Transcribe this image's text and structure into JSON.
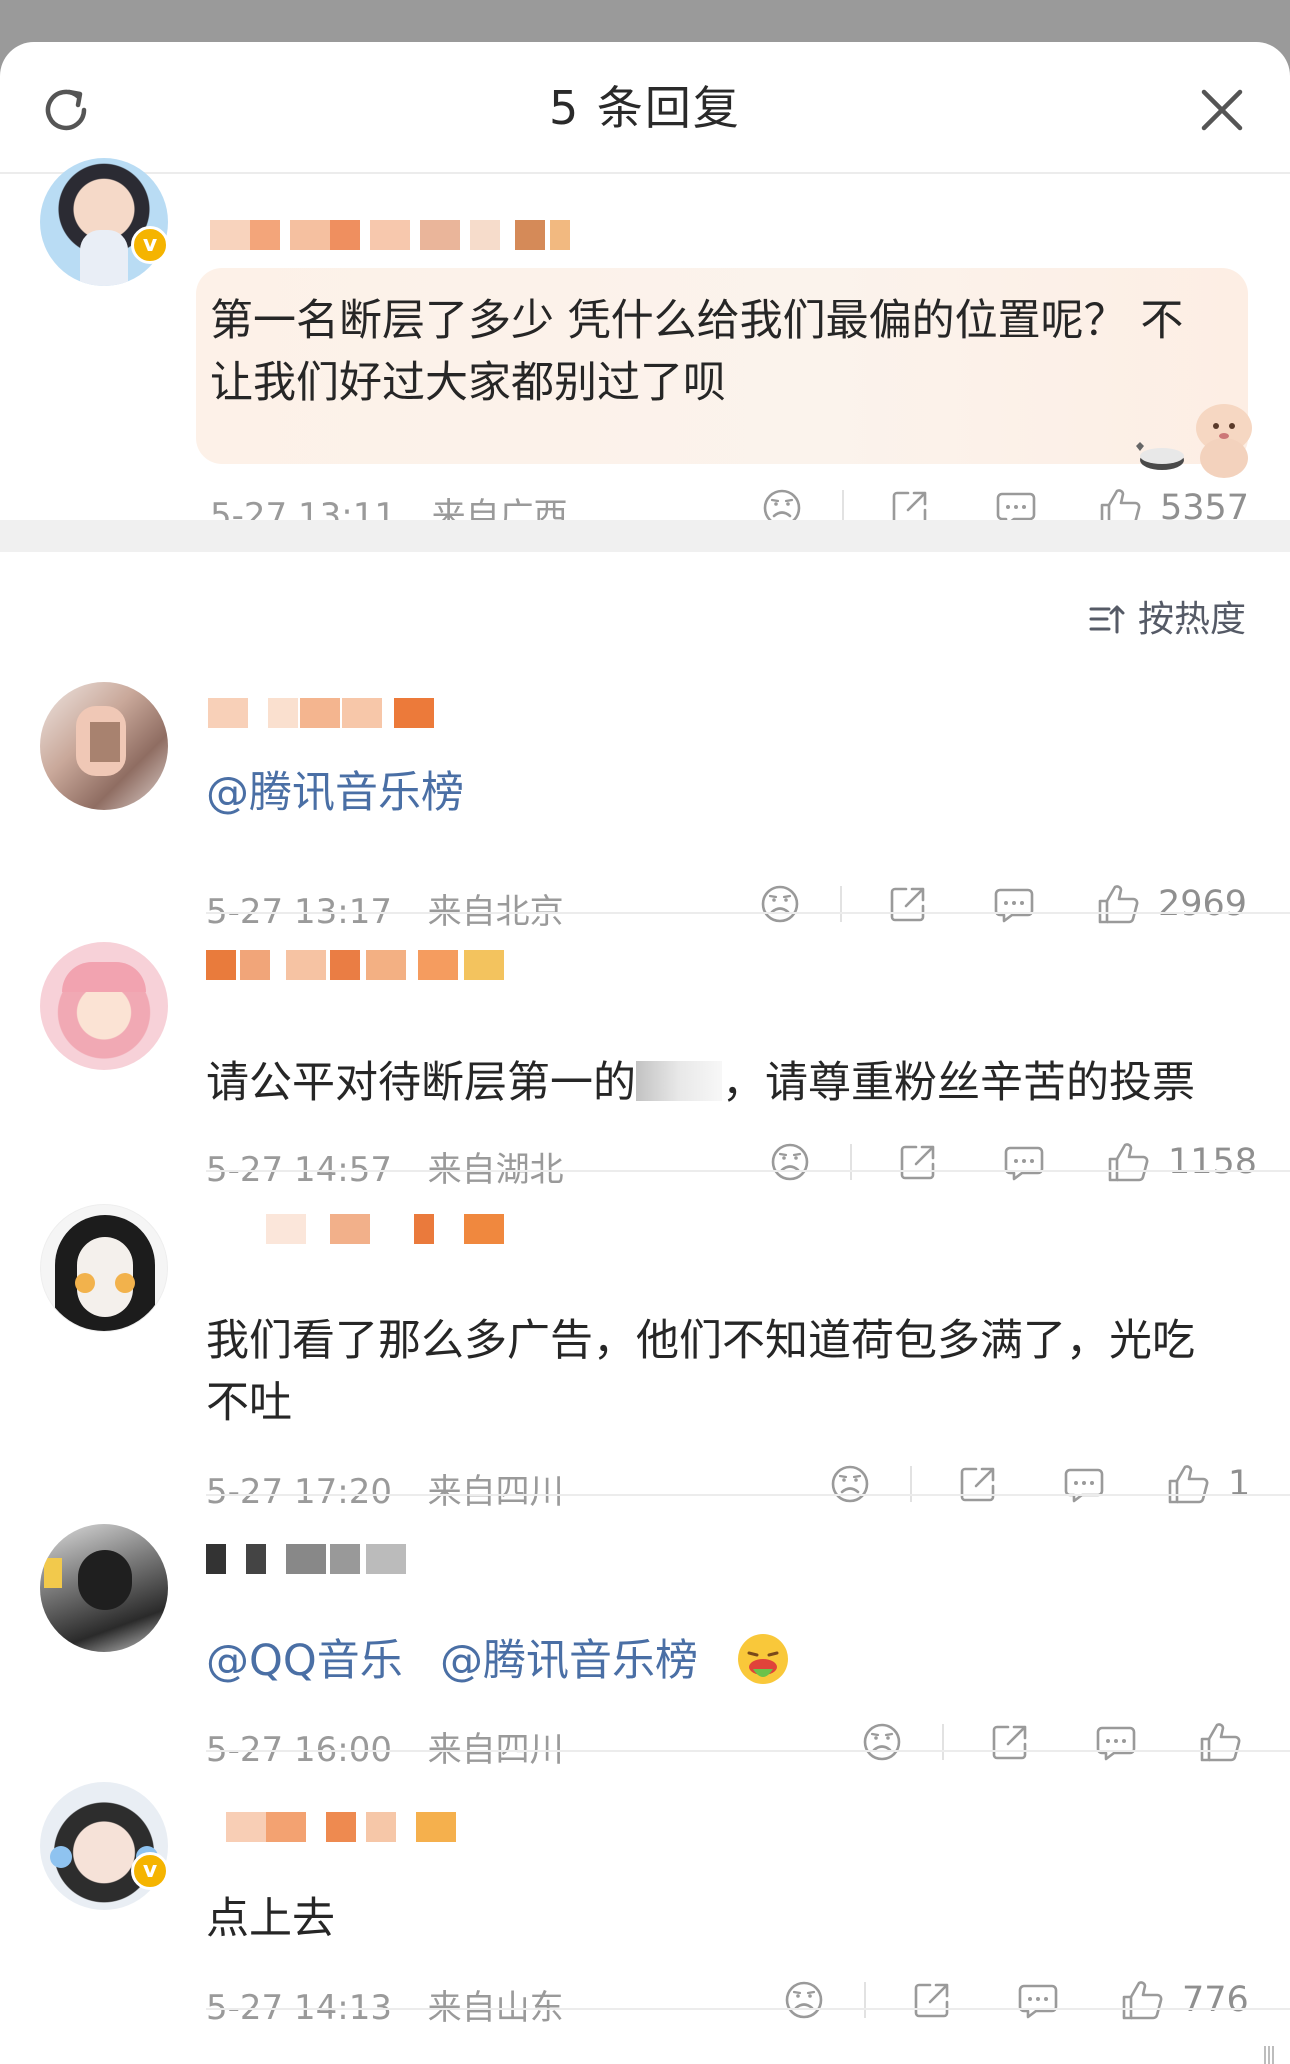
{
  "header": {
    "title": "5 条回复"
  },
  "main_comment": {
    "text": "第一名断层了多少 凭什么给我们最偏的位置呢？ 不让我们好过大家都别过了呗",
    "text_line1": "第一名断层了多少 凭什么给我们最偏的位置呢？ 不",
    "text_line2": "让我们好过大家都别过了呗",
    "time": "5-27 13:11",
    "location": "来自广西",
    "likes": "5357",
    "verified": true
  },
  "sort": {
    "label": "按热度"
  },
  "replies": [
    {
      "mention": "@腾讯音乐榜",
      "time": "5-27 13:17",
      "location": "来自北京",
      "likes": "2969"
    },
    {
      "text": "请公平对待断层第一的**，请尊重粉丝辛苦的投票",
      "text_a": "请公平对待断层第一的",
      "text_b": "，请尊重粉丝辛苦的投票",
      "time": "5-27 14:57",
      "location": "来自湖北",
      "likes": "1158"
    },
    {
      "text": "我们看了那么多广告，他们不知道荷包多满了，光吃不吐",
      "text_line1": "我们看了那么多广告，他们不知道荷包多满了，光吃",
      "text_line2": "不吐",
      "time": "5-27 17:20",
      "location": "来自四川",
      "likes": "1"
    },
    {
      "mention1": "@QQ音乐",
      "mention2": "@腾讯音乐榜",
      "time": "5-27 16:00",
      "location": "来自四川",
      "likes": ""
    },
    {
      "text": "点上去",
      "time": "5-27 14:13",
      "location": "来自山东",
      "likes": "776",
      "verified": true
    }
  ],
  "icons": {
    "refresh": "refresh-icon",
    "close": "close-icon",
    "dislike": "sad-face-icon",
    "share": "share-icon",
    "comment": "comment-icon",
    "like": "thumbs-up-icon",
    "sort": "sort-icon",
    "emoji": "vomit-emoji-icon"
  },
  "colors": {
    "mention": "#4a6fa5",
    "meta": "#9a9a9a",
    "verified_badge": "#f5b400"
  }
}
